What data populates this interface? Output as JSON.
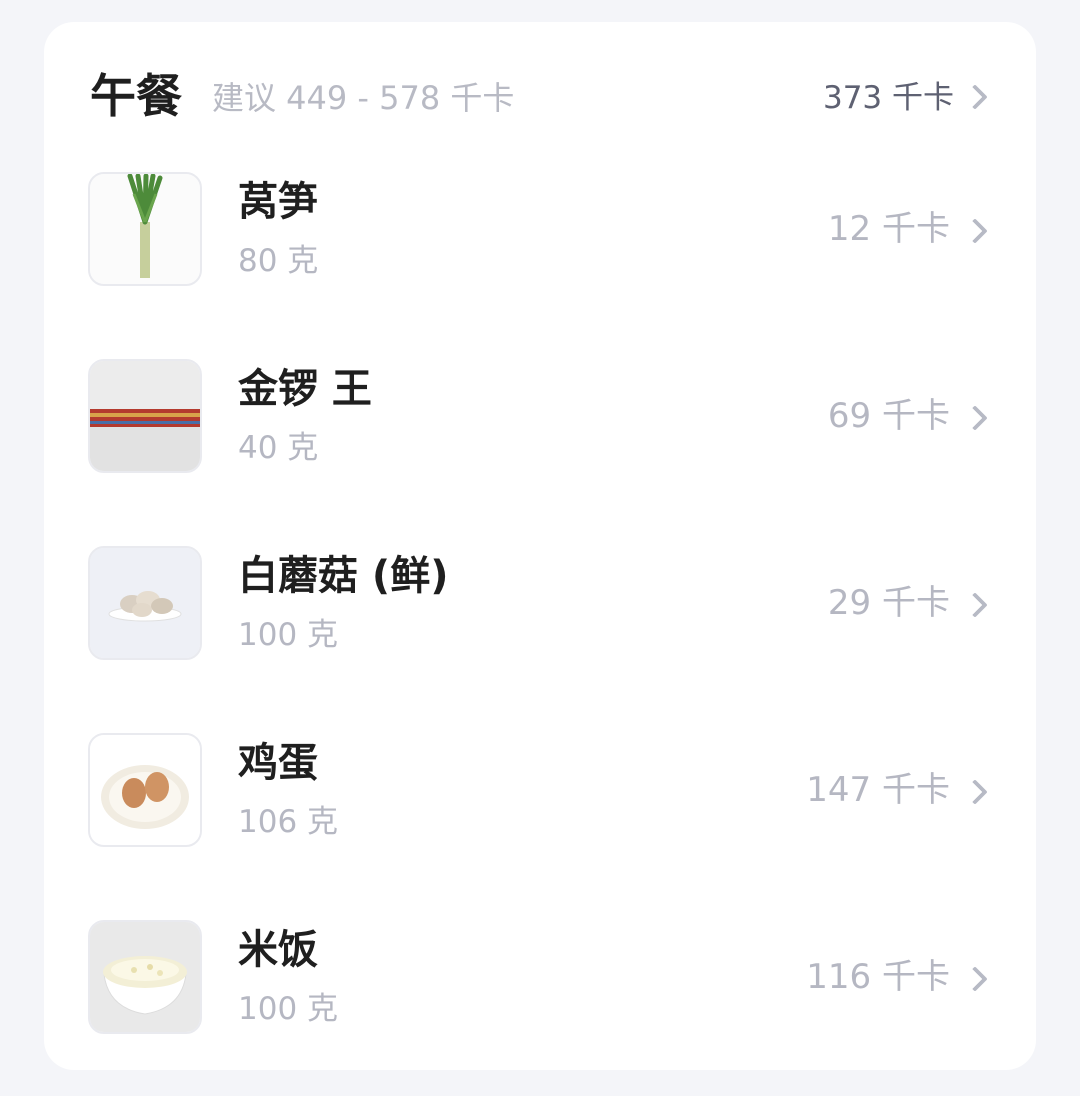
{
  "meal": {
    "title": "午餐",
    "suggestion": "建议 449 - 578 千卡",
    "total": "373 千卡"
  },
  "foods": [
    {
      "name": "莴笋",
      "weight": "80 克",
      "kcal": "12 千卡",
      "icon": "lettuce-stem-image"
    },
    {
      "name": "金锣 王",
      "weight": "40 克",
      "kcal": "69 千卡",
      "icon": "sausage-image"
    },
    {
      "name": "白蘑菇 (鲜)",
      "weight": "100 克",
      "kcal": "29 千卡",
      "icon": "mushroom-image"
    },
    {
      "name": "鸡蛋",
      "weight": "106 克",
      "kcal": "147 千卡",
      "icon": "egg-image"
    },
    {
      "name": "米饭",
      "weight": "100 克",
      "kcal": "116 千卡",
      "icon": "rice-image"
    }
  ],
  "colors": {
    "background": "#f4f5f9",
    "card": "#ffffff",
    "title_text": "#1f1f1f",
    "muted_text": "#b5b7c2",
    "total_text": "#5e6172"
  }
}
